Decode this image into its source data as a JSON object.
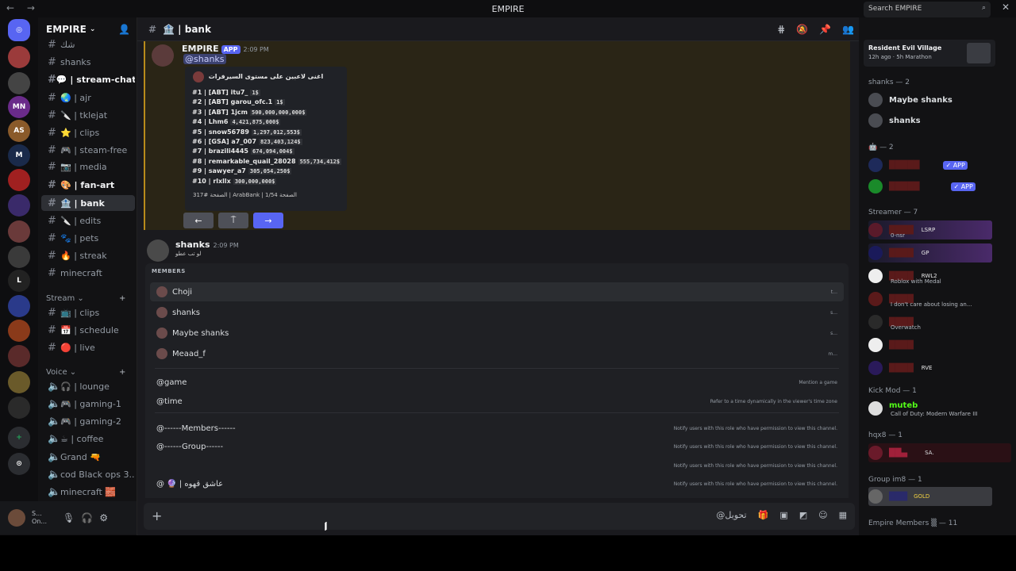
{
  "window": {
    "title": "EMPIRE",
    "controls": [
      "—",
      "☐",
      "✕"
    ]
  },
  "server": {
    "name": "EMPIRE"
  },
  "channels": [
    {
      "label": "شك",
      "bright": false
    },
    {
      "label": "shanks",
      "bright": false
    },
    {
      "label": "💬 | stream-chat",
      "bright": true
    },
    {
      "label": "🌏 | ajr",
      "bright": false
    },
    {
      "label": "🔪 | tklejat",
      "bright": false
    },
    {
      "label": "⭐ | clips",
      "bright": false
    },
    {
      "label": "🎮 | steam-free",
      "bright": false
    },
    {
      "label": "📷 | media",
      "bright": false
    },
    {
      "label": "🎨 | fan-art",
      "bright": true
    },
    {
      "label": "🔪 | edits",
      "bright": false
    },
    {
      "label": "🏦 | bank",
      "bright": true,
      "selected": true
    },
    {
      "label": "🐾 | pets",
      "bright": false
    },
    {
      "label": "🔥 | streak",
      "bright": false
    },
    {
      "label": "minecraft",
      "bright": false
    }
  ],
  "cat_stream": "Stream",
  "stream_channels": [
    "📺 | clips",
    "📅 | schedule",
    "🔴 | live"
  ],
  "cat_voice": "Voice",
  "voice_channels": [
    "🎧 | lounge",
    "🎮 | gaming-1",
    "🎮 | gaming-2",
    "☕ | coffee",
    "Grand 🔫",
    "cod Black ops 3...",
    "minecraft 🧱"
  ],
  "userbar": {
    "name": "S...",
    "status": "On..."
  },
  "channel": {
    "name": "🏦 | bank"
  },
  "message1": {
    "author": "EMPIRE",
    "badge": "APP",
    "time": "2:09 PM",
    "mention": "@shanks"
  },
  "embed": {
    "title": "اغنى لاعبين على مستوى السيرفرات",
    "rows": [
      {
        "label": "#1 | [ABT] itu7_",
        "value": "1$"
      },
      {
        "label": "#2 | [ABT] garou_ofc.1",
        "value": "1$"
      },
      {
        "label": "#3 | [ABT] 1jcm",
        "value": "500,000,000,000$"
      },
      {
        "label": "#4 | Lhm6",
        "value": "4,421,875,000$"
      },
      {
        "label": "#5 | snow56789",
        "value": "1,297,012,553$"
      },
      {
        "label": "#6 | [GSA] a7_007",
        "value": "823,403,124$"
      },
      {
        "label": "#7 | brazili4445",
        "value": "674,094,004$"
      },
      {
        "label": "#8 | remarkable_quail_28028",
        "value": "555,734,412$"
      },
      {
        "label": "#9 | sawyer_a7",
        "value": "305,054,250$"
      },
      {
        "label": "#10 | rlxllx",
        "value": "300,000,000$"
      }
    ],
    "footer": "317# الصفحة | ArabBank | 1/54 الصفحة"
  },
  "buttons": {
    "prev": "←",
    "mid": "⍑",
    "next": "→"
  },
  "message2": {
    "author": "shanks",
    "time": "2:09 PM",
    "text": "لو تب عطو"
  },
  "popup": {
    "header": "MEMBERS",
    "members": [
      {
        "name": "Choji",
        "right": "t..."
      },
      {
        "name": "shanks",
        "right": "s..."
      },
      {
        "name": "Maybe shanks",
        "right": "s..."
      },
      {
        "name": "Meaad_f",
        "right": "m..."
      }
    ],
    "commands": [
      {
        "name": "@game",
        "desc": "Mention a game"
      },
      {
        "name": "@time",
        "desc": "Refer to a time dynamically in the viewer's time zone"
      }
    ],
    "roles": [
      {
        "name": "@------Members------",
        "desc": "Notify users with this role who have permission to view this channel."
      },
      {
        "name": "@------Group------",
        "desc": "Notify users with this role who have permission to view this channel."
      },
      {
        "name": "",
        "desc": "Notify users with this role who have permission to view this channel."
      },
      {
        "name": "@ 🔮 | عاشق قهوه",
        "desc": "Notify users with this role who have permission to view this channel."
      }
    ]
  },
  "composer": {
    "label": "@تحويل"
  },
  "search": {
    "placeholder": "Search EMPIRE"
  },
  "activity": {
    "title": "Resident Evil Village",
    "sub": "12h ago  ·  5h Marathon"
  },
  "members_panel": {
    "g_shanks": "shanks — 2",
    "shanks_members": [
      "Maybe shanks",
      "shanks"
    ],
    "g_bots": "🤖 — 2",
    "bot_badge": "✓ APP",
    "g_streamer": "Streamer — 7",
    "streamer_acts": [
      "0-nsr",
      "",
      "Roblox with Medal",
      "I don't care about losing an...",
      "Overwatch",
      "",
      ""
    ],
    "streamer_tags": [
      "LSRP",
      "GP",
      "RWL2",
      "",
      "",
      "",
      "RVE"
    ],
    "g_kick": "Kick Mod — 1",
    "kick_name": "muteb",
    "kick_act": "Call of Duty: Modern Warfare III",
    "g_hqx": "hqx8 — 1",
    "hqx_tag": "SA.",
    "g_im8": "Group im8 — 1",
    "im8_tag": "GOLD",
    "g_empire": "Empire Members ▒ — 11"
  }
}
